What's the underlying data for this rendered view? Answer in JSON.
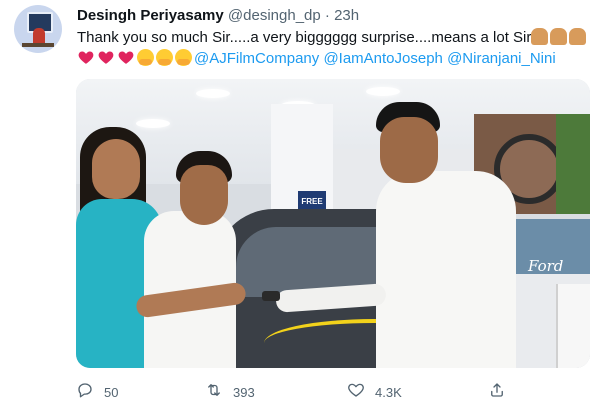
{
  "author": {
    "name": "Desingh Periyasamy",
    "handle": "@desingh_dp",
    "separator": "·",
    "time": "23h"
  },
  "tweet": {
    "line1": "Thank you so much Sir.....a very bigggggg surprise....means a lot Sir",
    "mentions": [
      "@AJFilmCompany",
      "@IamAntoJoseph",
      "@Niranjani_Nini"
    ]
  },
  "icons": {
    "line1_emojis": [
      "folded-hands-emoji",
      "folded-hands-emoji",
      "folded-hands-emoji"
    ],
    "line2_emojis": [
      "red-heart-emoji",
      "red-heart-emoji",
      "red-heart-emoji",
      "hugging-face-emoji",
      "hugging-face-emoji",
      "hugging-face-emoji"
    ],
    "reply": "reply-icon",
    "retweet": "retweet-icon",
    "like": "like-heart-icon",
    "share": "share-icon"
  },
  "photo": {
    "sign_text": "FREE",
    "brand_text": "Ford"
  },
  "stats": {
    "replies": "50",
    "retweets": "393",
    "likes": "4.3K"
  },
  "colors": {
    "link": "#1d9bf0",
    "secondary_text": "#536471",
    "heart": "#e0245e"
  }
}
